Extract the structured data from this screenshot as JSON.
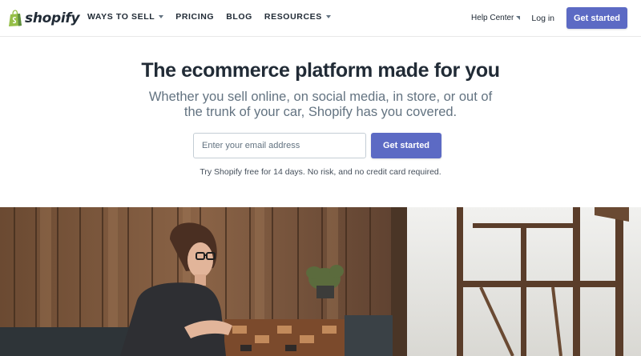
{
  "nav": {
    "logo_text": "shopify",
    "links": [
      {
        "label": "WAYS TO SELL",
        "dropdown": true
      },
      {
        "label": "PRICING",
        "dropdown": false
      },
      {
        "label": "BLOG",
        "dropdown": false
      },
      {
        "label": "RESOURCES",
        "dropdown": true
      }
    ],
    "help_center": "Help Center",
    "log_in": "Log in",
    "cta": "Get started"
  },
  "hero": {
    "title": "The ecommerce platform made for you",
    "subtitle": "Whether you sell online, on social media, in store, or out of the trunk of your car, Shopify has you covered.",
    "email_placeholder": "Enter your email address",
    "email_value": "",
    "cta": "Get started",
    "trial_note": "Try Shopify free for 14 days. No risk, and no credit card required."
  },
  "photo": {
    "subject": "hero-photo"
  },
  "colors": {
    "accent": "#5c6ac4",
    "text": "#212b36",
    "muted": "#637381",
    "logo_green": "#95bf47"
  }
}
